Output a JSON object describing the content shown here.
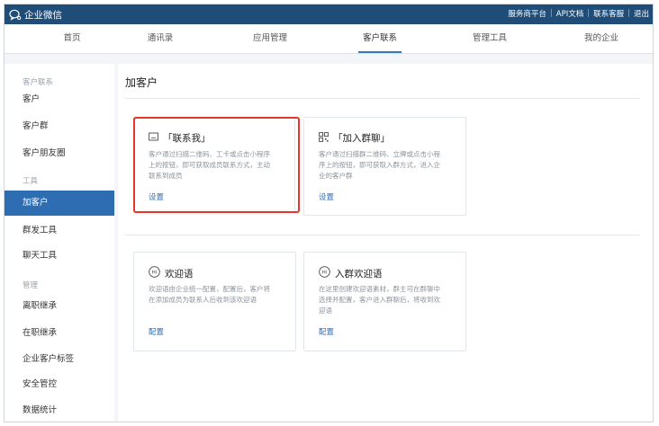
{
  "header": {
    "brand": "企业微信",
    "links": [
      "服务商平台",
      "API文档",
      "联系客服",
      "退出"
    ]
  },
  "nav": {
    "tabs": [
      {
        "label": "首页"
      },
      {
        "label": "通讯录"
      },
      {
        "label": "应用管理"
      },
      {
        "label": "客户联系",
        "active": true
      },
      {
        "label": "管理工具"
      },
      {
        "label": "我的企业"
      }
    ]
  },
  "sidebar": {
    "groups": [
      "客户联系",
      "工具",
      "管理"
    ],
    "items": [
      "客户",
      "客户群",
      "客户朋友圈",
      "加客户",
      "群发工具",
      "聊天工具",
      "离职继承",
      "在职继承",
      "企业客户标签",
      "安全管控",
      "数据统计"
    ],
    "active_item": "加客户"
  },
  "main": {
    "title": "加客户",
    "cards": [
      {
        "icon": "message-icon",
        "title": "「联系我」",
        "desc": [
          "客户通过扫描二维码、工卡或点击小程序",
          "上的按钮，即可获取成员联系方式，主动",
          "联系到成员"
        ],
        "link": "设置"
      },
      {
        "icon": "qr-code-icon",
        "title": "「加入群聊」",
        "desc": [
          "客户通过扫描群二维码、立牌或点击小程",
          "序上的按钮，即可获取入群方式，进入企",
          "业的客户群"
        ],
        "link": "设置"
      },
      {
        "icon": "hi-icon",
        "title": "欢迎语",
        "desc": [
          "欢迎语由企业统一配置，配置后，客户将",
          "在添加成员为联系人后收到该欢迎语"
        ],
        "link": "配置"
      },
      {
        "icon": "hi-icon",
        "title": "入群欢迎语",
        "desc": [
          "在这里创建欢迎语素材，群主可在群聊中",
          "选择并配置，客户进入群聊后，将收到欢",
          "迎语"
        ],
        "link": "配置"
      }
    ],
    "highlight_color": "#e8342f"
  }
}
